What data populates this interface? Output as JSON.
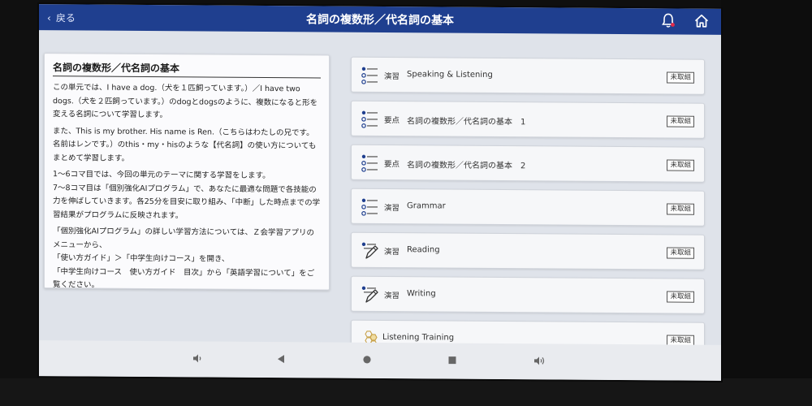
{
  "header": {
    "back_label": "戻る",
    "title": "名詞の複数形／代名詞の基本",
    "accent_color": "#1f3f8f",
    "notification_dot_color": "#e0294a"
  },
  "description": {
    "title": "名詞の複数形／代名詞の基本",
    "paragraphs": [
      "この単元では、I have a dog.（犬を１匹飼っています。）／I have two dogs.（犬を２匹飼っています。）のdogとdogsのように、複数になると形を変える名詞について学習します。",
      "また、This is my brother. His name is Ren.（こちらはわたしの兄です。名前はレンです。）のthis・my・hisのような【代名詞】の使い方についてもまとめて学習します。",
      "1～6コマ目では、今回の単元のテーマに関する学習をします。",
      "7～8コマ目は「個別強化AIプログラム」で、あなたに最適な問題で各技能の力を伸ばしていきます。各25分を目安に取り組み、「中断」した時点までの学習結果がプログラムに反映されます。",
      "「個別強化AIプログラム」の詳しい学習方法については、Ｚ会学習アプリのメニューから、",
      "「使い方ガイド」＞「中学生向けコース」を開き、",
      "「中学生向けコース　使い方ガイド　目次」から「英語学習について」をご覧ください。"
    ]
  },
  "lessons": [
    {
      "icon": "list-icon",
      "type": "演習",
      "title": "Speaking & Listening",
      "status": "未取組"
    },
    {
      "icon": "list-icon",
      "type": "要点",
      "title": "名詞の複数形／代名詞の基本　1",
      "status": "未取組"
    },
    {
      "icon": "list-icon",
      "type": "要点",
      "title": "名詞の複数形／代名詞の基本　2",
      "status": "未取組"
    },
    {
      "icon": "list-icon",
      "type": "演習",
      "title": "Grammar",
      "status": "未取組"
    },
    {
      "icon": "pencil-icon",
      "type": "演習",
      "title": "Reading",
      "status": "未取組"
    },
    {
      "icon": "pencil-icon",
      "type": "演習",
      "title": "Writing",
      "status": "未取組"
    },
    {
      "icon": "honeycomb-icon",
      "type": "",
      "title": "Listening Training",
      "status": "未取組"
    }
  ]
}
